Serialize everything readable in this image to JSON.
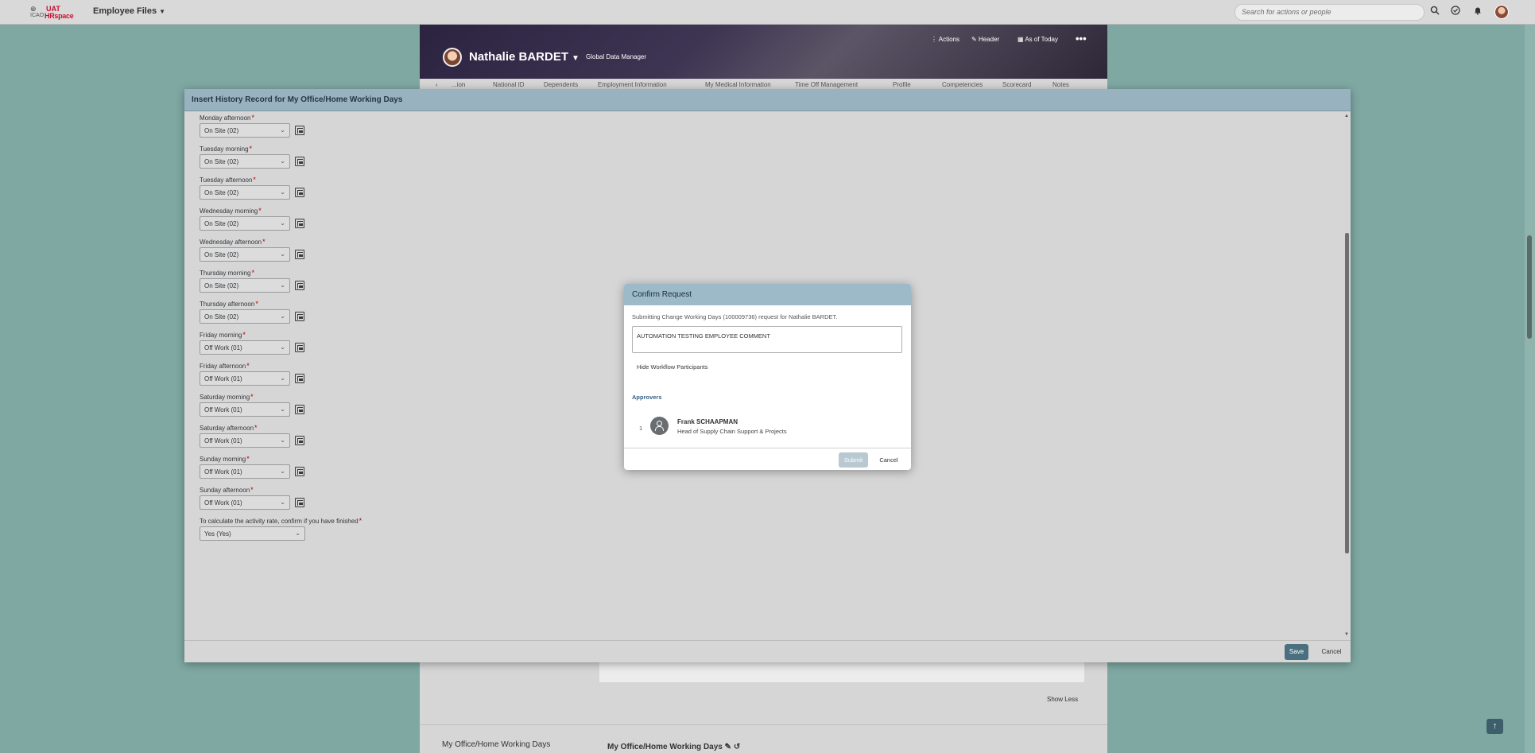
{
  "shell": {
    "logo_left": "ICAO",
    "logo_uat": "UAT",
    "logo_small": "ICAO",
    "logo_brand": "HRspace",
    "app_menu": "Employee Files",
    "search_placeholder": "Search for actions or people"
  },
  "header": {
    "employee_name": "Nathalie BARDET",
    "employee_title": "Global Data Manager",
    "actions_label": "Actions",
    "header_label": "Header",
    "as_of_label": "As of Today",
    "tabs": [
      "...ion",
      "National ID",
      "Dependents",
      "Employment Information",
      "My Medical Information",
      "Time Off Management",
      "Profile",
      "Competencies",
      "Scorecard",
      "Notes"
    ]
  },
  "background": {
    "show_less": "Show Less",
    "section_left": "My Office/Home Working Days",
    "section_right": "My Office/Home Working Days"
  },
  "dialog": {
    "title": "Insert History Record for My Office/Home Working Days",
    "fields": [
      {
        "label": "Monday afternoon",
        "value": "On Site (02)"
      },
      {
        "label": "Tuesday morning",
        "value": "On Site (02)"
      },
      {
        "label": "Tuesday afternoon",
        "value": "On Site (02)"
      },
      {
        "label": "Wednesday morning",
        "value": "On Site (02)"
      },
      {
        "label": "Wednesday afternoon",
        "value": "On Site (02)"
      },
      {
        "label": "Thursday morning",
        "value": "On Site (02)"
      },
      {
        "label": "Thursday afternoon",
        "value": "On Site (02)"
      },
      {
        "label": "Friday morning",
        "value": "Off Work (01)"
      },
      {
        "label": "Friday afternoon",
        "value": "Off Work (01)"
      },
      {
        "label": "Saturday morning",
        "value": "Off Work (01)"
      },
      {
        "label": "Saturday afternoon",
        "value": "Off Work (01)"
      },
      {
        "label": "Sunday morning",
        "value": "Off Work (01)"
      },
      {
        "label": "Sunday afternoon",
        "value": "Off Work (01)"
      }
    ],
    "activity_label": "To calculate the activity rate, confirm if you have finished",
    "activity_value": "Yes (Yes)",
    "save": "Save",
    "cancel": "Cancel"
  },
  "confirm": {
    "title": "Confirm Request",
    "message": "Submitting Change Working Days (100009736) request for Nathalie BARDET.",
    "comment": "AUTOMATION TESTING EMPLOYEE COMMENT",
    "hide_participants": "Hide Workflow Participants",
    "approvers_heading": "Approvers",
    "approver_index": "1",
    "approver_name": "Frank SCHAAPMAN",
    "approver_role": "Head of Supply Chain Support & Projects",
    "submit": "Submit",
    "cancel": "Cancel"
  }
}
